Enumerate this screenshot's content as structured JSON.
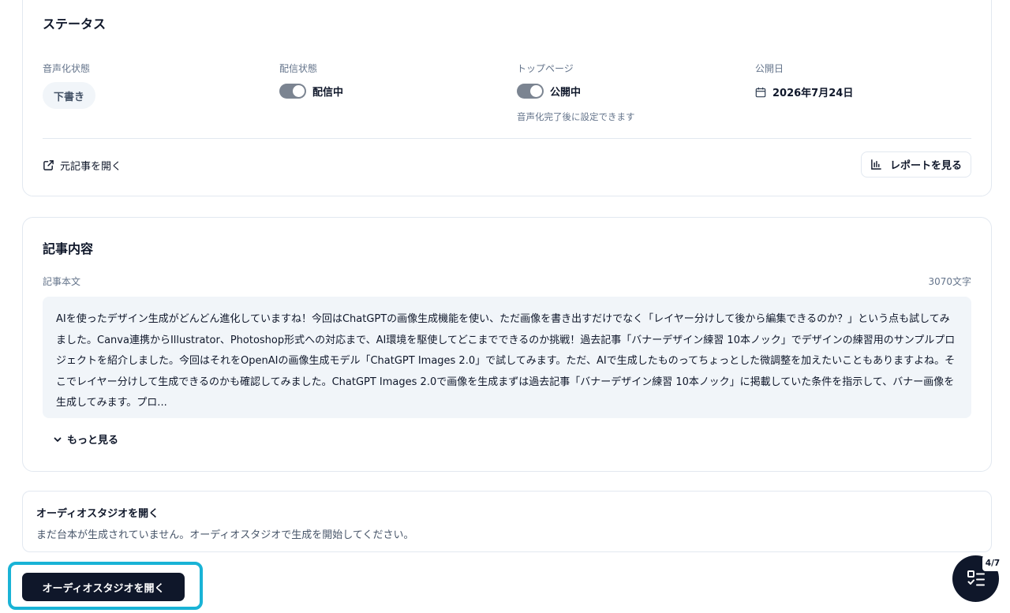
{
  "status": {
    "title": "ステータス",
    "audio_state": {
      "label": "音声化状態",
      "value": "下書き"
    },
    "delivery_state": {
      "label": "配信状態",
      "value": "配信中",
      "on": true
    },
    "top_page": {
      "label": "トップページ",
      "value": "公開中",
      "on": true,
      "hint": "音声化完了後に設定できます"
    },
    "publish_date": {
      "label": "公開日",
      "value": "2026年7月24日"
    },
    "open_original": "元記事を開く",
    "view_report": "レポートを見る"
  },
  "article": {
    "title": "記事内容",
    "body_label": "記事本文",
    "char_count": "3070文字",
    "excerpt": "AIを使ったデザイン生成がどんどん進化していますね！今回はChatGPTの画像生成機能を使い、ただ画像を書き出すだけでなく「レイヤー分けして後から編集できるのか？」という点も試してみました。Canva連携からIllustrator、Photoshop形式への対応まで、AI環境を駆使してどこまでできるのか挑戦！過去記事「バナーデザイン練習 10本ノック」でデザインの練習用のサンプルプロジェクトを紹介しました。今回はそれをOpenAIの画像生成モデル「ChatGPT Images 2.0」で試してみます。ただ、AIで生成したものってちょっとした微調整を加えたいこともありますよね。そこでレイヤー分けして生成できるのかも確認してみました。ChatGPT Images 2.0で画像を生成まずは過去記事「バナーデザイン練習 10本ノック」に掲載していた条件を指示して、バナー画像を生成してみます。プロ...",
    "show_more": "もっと見る"
  },
  "audio_studio": {
    "title": "オーディオスタジオを開く",
    "description": "まだ台本が生成されていません。オーディオスタジオで生成を開始してください。",
    "button_label": "オーディオスタジオを開く"
  },
  "checklist": {
    "progress": "4/7"
  },
  "colors": {
    "primary": "#0f172a",
    "highlight": "#19b3d6",
    "toggle": "#7b8491",
    "muted": "#64748b"
  }
}
